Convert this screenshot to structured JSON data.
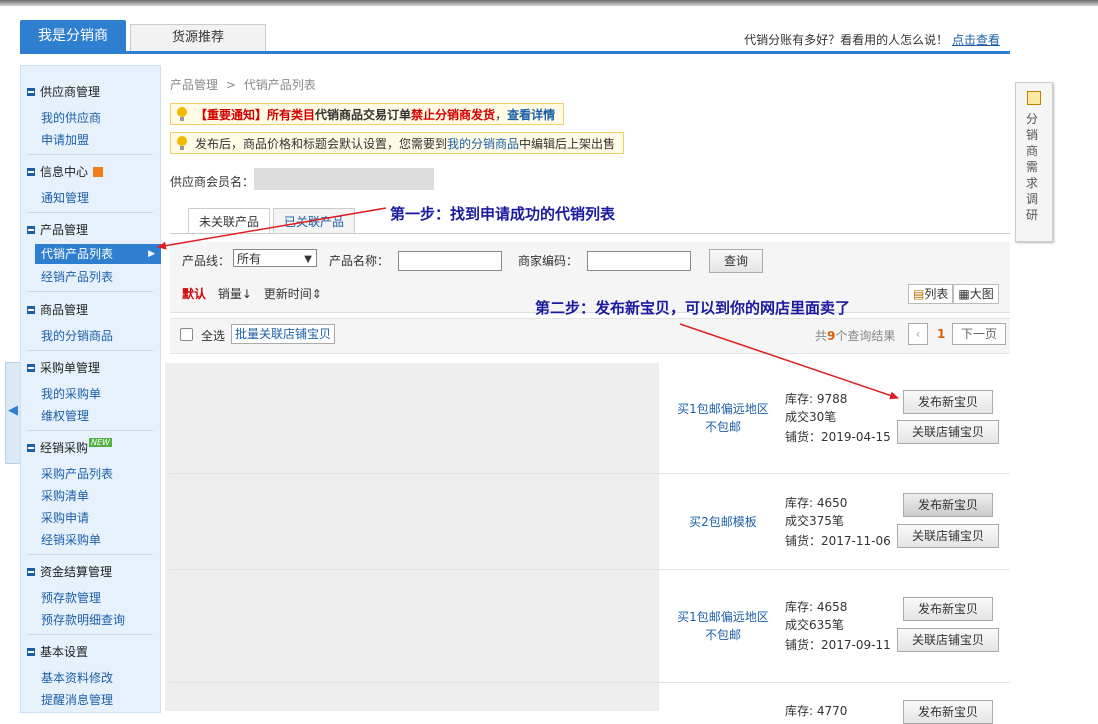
{
  "header": {
    "tab_main": "我是分销商",
    "tab_secondary": "货源推荐",
    "promo_text": "代销分账有多好？看看用的人怎么说！",
    "promo_link": "点击查看"
  },
  "sidebar": {
    "sections": [
      {
        "title": "供应商管理",
        "items": [
          "我的供应商",
          "申请加盟"
        ]
      },
      {
        "title": "信息中心",
        "items": [
          "通知管理"
        ]
      },
      {
        "title": "产品管理",
        "items": [
          "代销产品列表",
          "经销产品列表"
        ]
      },
      {
        "title": "商品管理",
        "items": [
          "我的分销商品"
        ]
      },
      {
        "title": "采购单管理",
        "items": [
          "我的采购单",
          "维权管理"
        ]
      },
      {
        "title": "经销采购",
        "badge": "NEW",
        "items": [
          "采购产品列表",
          "采购清单",
          "采购申请",
          "经销采购单"
        ]
      },
      {
        "title": "资金结算管理",
        "items": [
          "预存款管理",
          "预存款明细查询"
        ]
      },
      {
        "title": "基本设置",
        "items": [
          "基本资料修改",
          "提醒消息管理"
        ]
      }
    ]
  },
  "breadcrumb": {
    "root": "产品管理",
    "separator": ">",
    "current": "代销产品列表"
  },
  "notice1": {
    "tag": "【重要通知】",
    "part1": "所有类目",
    "part2": "代销商品交易订单",
    "part3": "禁止分销商发货",
    "sep": "，",
    "link": "查看详情"
  },
  "notice2": {
    "text1": "发布后，商品价格和标题会默认设置，您需要到",
    "link": "我的分销商品",
    "text2": "中编辑后上架出售"
  },
  "member": {
    "label": "供应商会员名："
  },
  "product_tabs": [
    "未关联产品",
    "已关联产品"
  ],
  "filter": {
    "line_label": "产品线：",
    "line_value": "所有",
    "name_label": "产品名称：",
    "code_label": "商家编码：",
    "query_button": "查询",
    "sort_default": "默认",
    "sort_sales": "销量",
    "sort_updated": "更新时间",
    "view_list": "列表",
    "view_grid": "大图"
  },
  "bulkbar": {
    "select_all": "全选",
    "bulk_button": "批量关联店铺宝贝",
    "total_prefix": "共",
    "total_count": "9",
    "total_suffix": "个查询结果",
    "page": "1",
    "next": "下一页"
  },
  "products": [
    {
      "shipping": "买1包邮偏远地区不包邮",
      "stock": "库存: 9788",
      "deals": "成交30笔",
      "date": "铺货：2019-04-15",
      "publish": "发布新宝贝",
      "link": "关联店铺宝贝"
    },
    {
      "shipping": "买2包邮模板",
      "stock": "库存: 4650",
      "deals": "成交375笔",
      "date": "铺货：2017-11-06",
      "publish": "发布新宝贝",
      "link": "关联店铺宝贝"
    },
    {
      "shipping": "买1包邮偏远地区不包邮",
      "stock": "库存: 4658",
      "deals": "成交635笔",
      "date": "铺货：2017-09-11",
      "publish": "发布新宝贝",
      "link": "关联店铺宝贝"
    },
    {
      "stock": "库存: 4770",
      "publish": "发布新宝贝"
    }
  ],
  "annotations": {
    "step1": "第一步：找到申请成功的代销列表",
    "step2": "第二步：发布新宝贝，可以到你的网店里面卖了",
    "arrow_color": "#e02020"
  },
  "survey": {
    "label": "分销商需求调研"
  },
  "colors": {
    "accent": "#2f7fd0",
    "link": "#1c5fa8",
    "alert": "#d40000",
    "count": "#e06000"
  }
}
